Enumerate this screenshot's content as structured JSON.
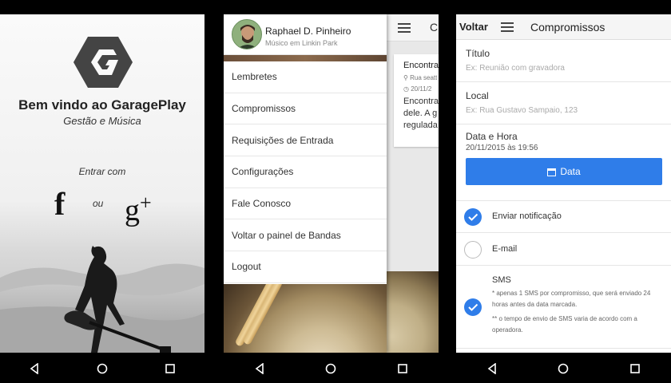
{
  "screen1": {
    "title": "Bem vindo ao GaragePlay",
    "subtitle": "Gestão e Música",
    "enter_with": "Entrar com",
    "facebook_glyph": "f",
    "or_label": "ou",
    "gplus_glyph": "g",
    "gplus_sup": "+"
  },
  "screen2": {
    "user_name": "Raphael D. Pinheiro",
    "user_subtitle": "Músico em Linkin Park",
    "menu": [
      {
        "label": "Lembretes"
      },
      {
        "label": "Compromissos"
      },
      {
        "label": "Requisições de Entrada"
      },
      {
        "label": "Configurações"
      },
      {
        "label": "Fale Conosco"
      },
      {
        "label": "Voltar o painel de Bandas"
      },
      {
        "label": "Logout"
      }
    ],
    "behind": {
      "title": "C",
      "card_title": "Encontra",
      "card_location": "Rua seatt",
      "card_date": "20/11/2",
      "card_text_1": "Encontra",
      "card_text_2": "dele. A g",
      "card_text_3": "regulada"
    }
  },
  "screen3": {
    "back": "Voltar",
    "title": "Compromissos",
    "titulo_label": "Título",
    "titulo_placeholder": "Ex: Reunião com gravadora",
    "local_label": "Local",
    "local_placeholder": "Ex: Rua Gustavo Sampaio, 123",
    "datetime_label": "Data e Hora",
    "datetime_value": "20/11/2015 às 19:56",
    "data_button": "Data",
    "opt_notify": "Enviar notificação",
    "opt_email": "E-mail",
    "opt_sms": "SMS",
    "sms_note_1": "* apenas 1 SMS por compromisso, que será enviado 24 horas antes da data marcada.",
    "sms_note_2": "** o tempo de envio de SMS varia de acordo com a operadora."
  },
  "colors": {
    "accent": "#2f7de9",
    "navbar": "#000000"
  },
  "icons": [
    "back-triangle-icon",
    "home-circle-icon",
    "recents-square-icon",
    "hamburger-icon",
    "calendar-icon",
    "check-icon",
    "location-icon",
    "clock-icon"
  ]
}
